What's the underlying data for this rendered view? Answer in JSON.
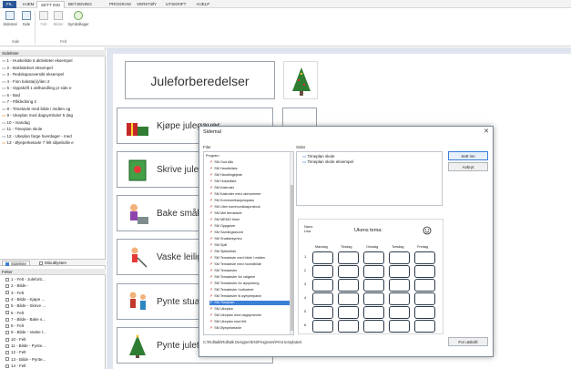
{
  "menu": {
    "tabs": [
      "FIL",
      "HJEM",
      "SETT INN",
      "BETJENING",
      "PROGRAM",
      "VERKTØY",
      "UTSKRIFT",
      "HJELP"
    ]
  },
  "ribbon": {
    "buttons": [
      "Sidemal",
      "Side",
      "Felt",
      "Bilder",
      "Symbollager"
    ],
    "groups": [
      "Side",
      "Felt"
    ]
  },
  "left_panel": {
    "pages_header": "Sidelister",
    "pages": [
      "1 - Huskeliste 6 aktiviteter eksempel",
      "2 - Boklistekort eksempel",
      "3 - Redskapsoversikt eksempel",
      "4 - Finn boksta(v)/ilen 2",
      "5 - Oppskrift 1 delhandling pr side e",
      "6 - Bad",
      "7 - Påkledning 2",
      "8 - Timetavle med bilde i midten og",
      "9 - Ukeplan med dagsymboler 5 dag",
      "10 - mandag",
      "11 - Timeplan skole",
      "12 - Ukeplan farge hverdager - med",
      "13 - Øyeperketavle 7 felt såpebolle e"
    ],
    "tab_pages": "Sideliste",
    "tab_minutes": "Minuttlysten",
    "fields_header": "Felter",
    "fields": [
      "1 - Felt - Juleforb...",
      "2 - Bilde -",
      "3 - Felt",
      "4 - Bilde - Kjøpe ...",
      "5 - Bilde - Skrive ...",
      "6 - Felt",
      "7 - Bilde - Bake s...",
      "8 - Felt",
      "9 - Bilde - Vaske l...",
      "10 - Felt",
      "11 - Bilde - Pynte...",
      "12 - Felt",
      "13 - Bilde - Pynte...",
      "14 - Felt"
    ]
  },
  "document": {
    "title": "Juleforberedelser",
    "cards": [
      "Kjøpe julegaver",
      "Skrive juleko",
      "Bake småkak",
      "Vaske leiligh",
      "Pynte stua",
      "Pynte juletre"
    ]
  },
  "dialog": {
    "title": "Sidemal",
    "files_label": "Filer",
    "pages_label": "Sider",
    "files": [
      "Program",
      "SM God Alik",
      "SM Handleliste",
      "SM Handlingkjede",
      "SM Huskeliste",
      "SM Kalender",
      "SM Kalender med ukenummer",
      "SM Kommunikasjonspass",
      "SM Liten kommunikasjonsbok",
      "SM Mel tematavle",
      "SM MEMO timer",
      "SM Oppgaver",
      "SM Samlingsstund",
      "SM Snakkesymbo",
      "SM Spill",
      "SM Sjekkbilde",
      "SM Tematavle med bilde i midten",
      "SM Tematavle med hovedbilde",
      "SM Tematavler",
      "SM Tematavler for valgene",
      "SM Tematavler for øyepeking",
      "SM Tematavler hurtiurtest",
      "SM Tematavler til øyepeepanin",
      "SM Timeplan",
      "SM Ukeplan",
      "SM Ukeplan med dagsymboler",
      "SM Ukeplan med felt",
      "SM Øyepeketavle"
    ],
    "selected_file": "SM Timeplan",
    "pages": [
      "Timeplan skole",
      "Timeplan skole eksempel"
    ],
    "btn_insert": "Sett inn",
    "btn_cancel": "Avbryt",
    "btn_print": "For utskrift",
    "path": "C:\\Rolltalk\\Rolltalk Designer\\EN\\Programs\\Print templates\\",
    "preview": {
      "name_label": "Navn:",
      "name_value": "Lisa",
      "heading": "Ukens tema:",
      "days": [
        "Mandag",
        "Tirsdag",
        "Onsdag",
        "Torsdag",
        "Fredag"
      ],
      "rows": [
        "1",
        "2",
        "3",
        "4",
        "5",
        "6"
      ]
    }
  }
}
